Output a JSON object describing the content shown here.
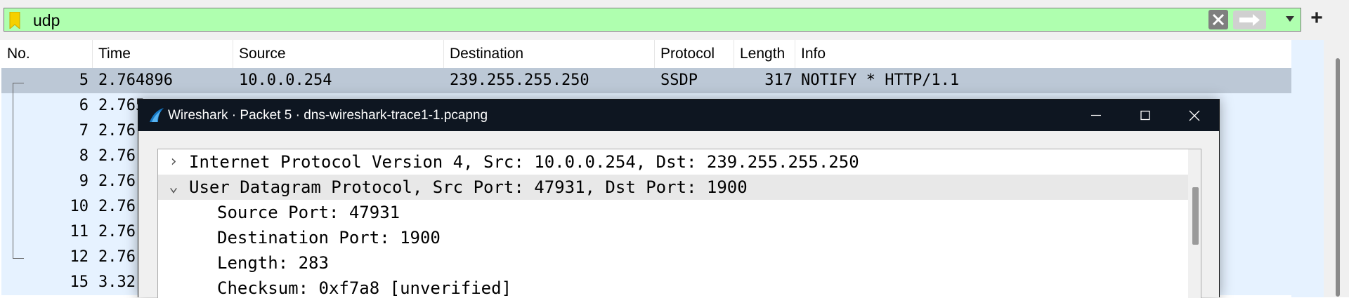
{
  "filter": {
    "value": "udp",
    "add_label": "+"
  },
  "columns": [
    "No.",
    "Time",
    "Source",
    "Destination",
    "Protocol",
    "Length",
    "Info"
  ],
  "packets": [
    {
      "no": "5",
      "time": "2.764896",
      "source": "10.0.0.254",
      "destination": "239.255.255.250",
      "protocol": "SSDP",
      "length": "317",
      "info": "NOTIFY * HTTP/1.1"
    },
    {
      "no": "6",
      "time": "2.765",
      "source": "",
      "destination": "",
      "protocol": "",
      "length": "",
      "info": ""
    },
    {
      "no": "7",
      "time": "2.76",
      "source": "",
      "destination": "",
      "protocol": "",
      "length": "",
      "info": ""
    },
    {
      "no": "8",
      "time": "2.76",
      "source": "",
      "destination": "",
      "protocol": "",
      "length": "",
      "info": ""
    },
    {
      "no": "9",
      "time": "2.76",
      "source": "",
      "destination": "",
      "protocol": "",
      "length": "",
      "info": ""
    },
    {
      "no": "10",
      "time": "2.76",
      "source": "",
      "destination": "",
      "protocol": "",
      "length": "",
      "info": ""
    },
    {
      "no": "11",
      "time": "2.76",
      "source": "",
      "destination": "",
      "protocol": "",
      "length": "",
      "info": ""
    },
    {
      "no": "12",
      "time": "2.76",
      "source": "",
      "destination": "",
      "protocol": "",
      "length": "",
      "info": ""
    },
    {
      "no": "15",
      "time": "3.32",
      "source": "",
      "destination": "",
      "protocol": "",
      "length": "",
      "info": ""
    }
  ],
  "dialog": {
    "title": "Wireshark · Packet 5 · dns-wireshark-trace1-1.pcapng",
    "tree": [
      {
        "caret": "›",
        "text": "Internet Protocol Version 4, Src: 10.0.0.254, Dst: 239.255.255.250"
      },
      {
        "caret": "⌄",
        "text": "User Datagram Protocol, Src Port: 47931, Dst Port: 1900"
      },
      {
        "caret": "",
        "text": "Source Port: 47931"
      },
      {
        "caret": "",
        "text": "Destination Port: 1900"
      },
      {
        "caret": "",
        "text": "Length: 283"
      },
      {
        "caret": "",
        "text": "Checksum: 0xf7a8 [unverified]"
      }
    ]
  },
  "colors": {
    "filter_valid": "#afffaf",
    "row_bg": "#e6f2ff",
    "row_selected": "#bcc8d6",
    "titlebar": "#0e1621",
    "bookmark": "#f5d000"
  }
}
